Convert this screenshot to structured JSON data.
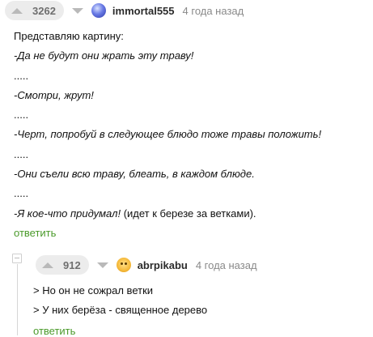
{
  "comments": [
    {
      "votes": "3262",
      "username": "immortal555",
      "time": "4 года назад",
      "lines": [
        "Представляю картину:",
        "-Да не будут они жрать эту траву!",
        ".....",
        "-Смотри, жрут!",
        ".....",
        "-Черт, попробуй в следующее блюдо тоже травы положить!",
        ".....",
        "-Они съели всю траву, блеать, в каждом блюде.",
        ".....",
        "-Я кое-что придумал!",
        " (идет к березе за ветками)."
      ],
      "reply_label": "ответить"
    },
    {
      "votes": "912",
      "username": "abrpikabu",
      "time": "4 года назад",
      "lines": [
        "> Но он не сожрал ветки",
        "> У них берёза - священное дерево"
      ],
      "reply_label": "ответить"
    }
  ],
  "colors": {
    "reply_link": "#4a9a2a",
    "vote_bg": "#ececec"
  },
  "icons": {
    "upvote": "triangle-up-icon",
    "downvote": "triangle-down-icon",
    "collapse": "minus-box-icon"
  }
}
